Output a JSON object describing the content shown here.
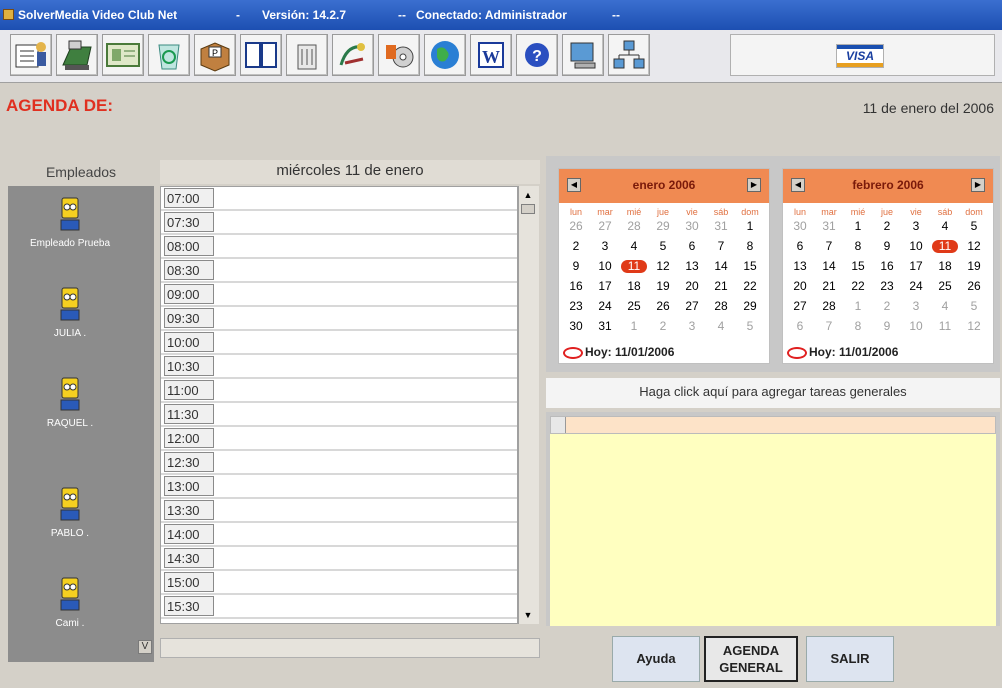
{
  "window": {
    "app_name": "SolverMedia Video Club Net",
    "version": "Versión: 14.2.7",
    "connection": "Conectado: Administrador",
    "sep1": "-",
    "sep2": "--",
    "sep3": "--"
  },
  "toolbar": {
    "buttons": [
      "register-icon",
      "cash-register-icon",
      "id-card-icon",
      "recycle-icon",
      "box-icon",
      "book-icon",
      "trash-icon",
      "tools-icon",
      "media-icon",
      "globe-icon",
      "word-icon",
      "help-icon",
      "computer-icon",
      "network-icon"
    ],
    "visa_label": "VISA"
  },
  "agenda": {
    "title": "AGENDA DE:",
    "date": "11 de enero del 2006"
  },
  "employees": {
    "header": "Empleados",
    "items": [
      {
        "name": "Empleado Prueba"
      },
      {
        "name": "JULIA ."
      },
      {
        "name": "RAQUEL ."
      },
      {
        "name": "PABLO ."
      },
      {
        "name": "Cami ."
      }
    ],
    "scroll_label": "V"
  },
  "schedule": {
    "day_header": "miércoles 11 de enero",
    "slots": [
      "07:00",
      "07:30",
      "08:00",
      "08:30",
      "09:00",
      "09:30",
      "10:00",
      "10:30",
      "11:00",
      "11:30",
      "12:00",
      "12:30",
      "13:00",
      "13:30",
      "14:00",
      "14:30",
      "15:00",
      "15:30"
    ]
  },
  "calendars": [
    {
      "title": "enero 2006",
      "dow": [
        "lun",
        "mar",
        "mié",
        "jue",
        "vie",
        "sáb",
        "dom"
      ],
      "weeks": [
        [
          "26",
          "27",
          "28",
          "29",
          "30",
          "31",
          "1"
        ],
        [
          "2",
          "3",
          "4",
          "5",
          "6",
          "7",
          "8"
        ],
        [
          "9",
          "10",
          "11",
          "12",
          "13",
          "14",
          "15"
        ],
        [
          "16",
          "17",
          "18",
          "19",
          "20",
          "21",
          "22"
        ],
        [
          "23",
          "24",
          "25",
          "26",
          "27",
          "28",
          "29"
        ],
        [
          "30",
          "31",
          "1",
          "2",
          "3",
          "4",
          "5"
        ]
      ],
      "selected": "11",
      "today_label": "Hoy: 11/01/2006"
    },
    {
      "title": "febrero 2006",
      "dow": [
        "lun",
        "mar",
        "mié",
        "jue",
        "vie",
        "sáb",
        "dom"
      ],
      "weeks": [
        [
          "30",
          "31",
          "1",
          "2",
          "3",
          "4",
          "5"
        ],
        [
          "6",
          "7",
          "8",
          "9",
          "10",
          "11",
          "12"
        ],
        [
          "13",
          "14",
          "15",
          "16",
          "17",
          "18",
          "19"
        ],
        [
          "20",
          "21",
          "22",
          "23",
          "24",
          "25",
          "26"
        ],
        [
          "27",
          "28",
          "1",
          "2",
          "3",
          "4",
          "5"
        ],
        [
          "6",
          "7",
          "8",
          "9",
          "10",
          "11",
          "12"
        ]
      ],
      "selected": "11",
      "today_label": "Hoy: 11/01/2006"
    }
  ],
  "tasks": {
    "link": "Haga click aquí para agregar tareas generales"
  },
  "buttons": {
    "help": "Ayuda",
    "general_line1": "AGENDA",
    "general_line2": "GENERAL",
    "exit": "SALIR"
  },
  "colors": {
    "title_red": "#e03020",
    "calendar_header": "#f08a52",
    "selected_day": "#e03a18",
    "tasks_bg": "#ffffc0",
    "employee_panel": "#8c8c8c"
  }
}
